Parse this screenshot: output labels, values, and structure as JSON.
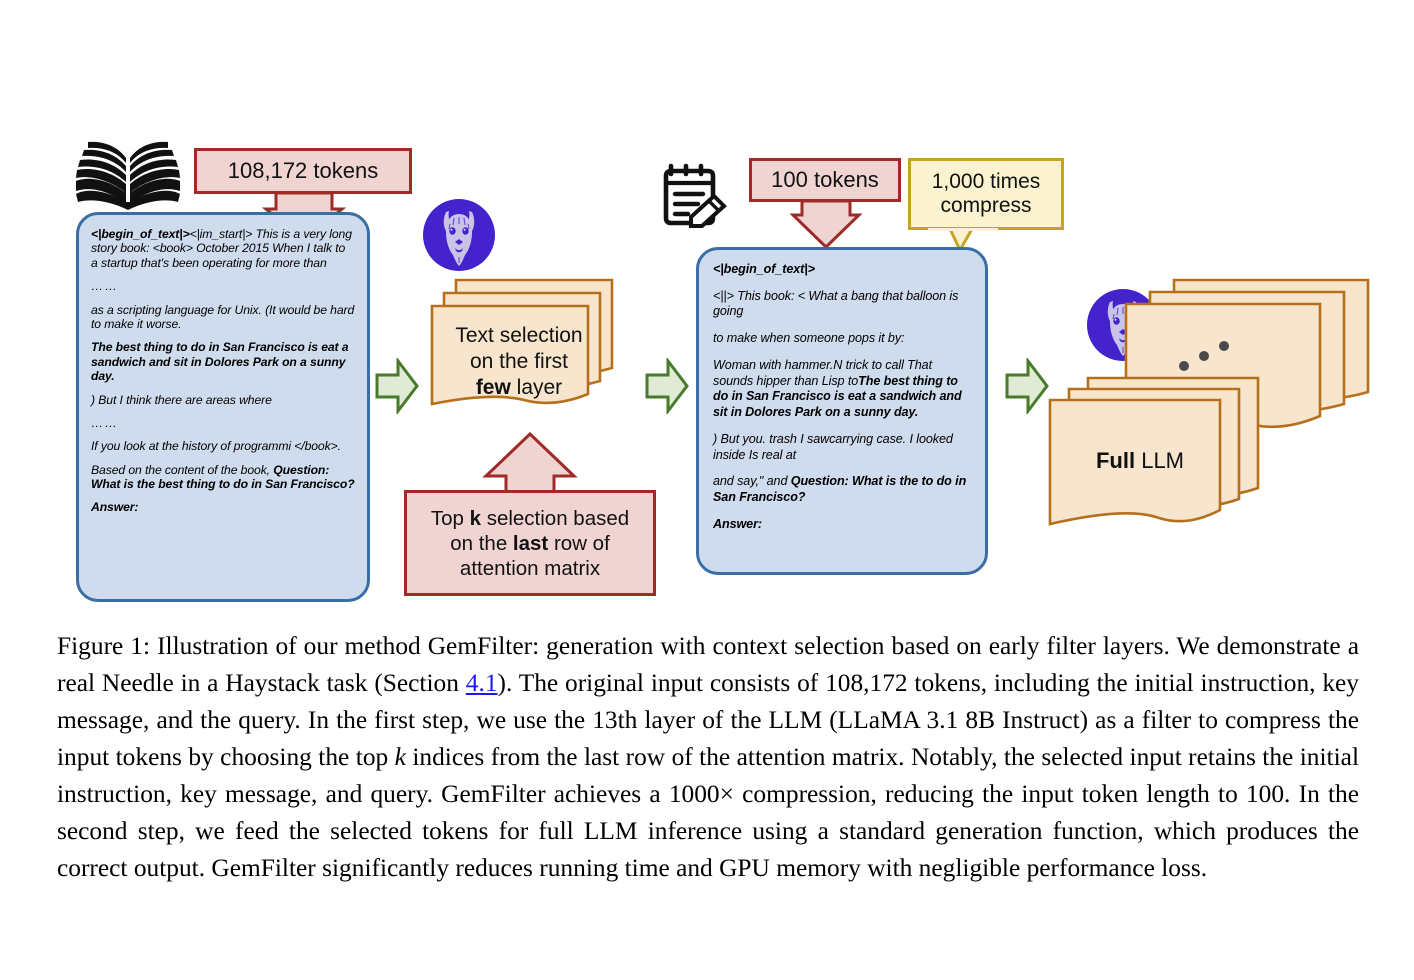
{
  "figure": {
    "icons": {
      "book": "open-book-icon",
      "notepad": "notepad-pencil-icon",
      "llama": "llama-avatar-icon"
    },
    "callouts": {
      "input_tokens": "108,172 tokens",
      "output_tokens": "100 tokens",
      "compress_line1": "1,000 times",
      "compress_line2": "compress"
    },
    "left_prompt": {
      "name": "original-input-prompt",
      "lines": [
        {
          "id": "l1",
          "segments": [
            {
              "text": "<|begin_of_text|>",
              "bold": true
            },
            {
              "text": "<|im_start|> This is a very long story book: <book> October 2015 When I talk to a startup that's been operating for more than",
              "bold": false
            }
          ]
        },
        {
          "id": "l2",
          "segments": [
            {
              "text": "……",
              "bold": false
            }
          ]
        },
        {
          "id": "l3",
          "segments": [
            {
              "text": "as a scripting language for Unix. (It would be hard to make it worse.",
              "bold": false
            }
          ]
        },
        {
          "id": "l4",
          "segments": [
            {
              "text": "The best thing to do in San Francisco is eat a sandwich and sit in Dolores Park on a sunny day.",
              "bold": true
            }
          ]
        },
        {
          "id": "l5",
          "segments": [
            {
              "text": ") But I think there are areas where",
              "bold": false
            }
          ]
        },
        {
          "id": "l6",
          "segments": [
            {
              "text": "……",
              "bold": false
            }
          ]
        },
        {
          "id": "l7",
          "segments": [
            {
              "text": "If you look at the history of programmi </book>.",
              "bold": false
            }
          ]
        },
        {
          "id": "l8",
          "segments": [
            {
              "text": "Based on the content of the book, ",
              "bold": false
            },
            {
              "text": "Question: What is the best thing to do in San Francisco?",
              "bold": true
            }
          ]
        },
        {
          "id": "l9",
          "segments": [
            {
              "text": "Answer:",
              "bold": true
            }
          ]
        }
      ]
    },
    "right_prompt": {
      "name": "compressed-input-prompt",
      "lines": [
        {
          "id": "r1",
          "segments": [
            {
              "text": "<|begin_of_text|>",
              "bold": true
            }
          ]
        },
        {
          "id": "r2",
          "segments": [
            {
              "text": "<||> This book: < What a bang that balloon is going",
              "bold": false
            }
          ]
        },
        {
          "id": "r3",
          "segments": [
            {
              "text": "to make when someone pops it by:",
              "bold": false
            }
          ]
        },
        {
          "id": "r4",
          "segments": [
            {
              "text": "Woman with hammer.N trick to call That sounds hipper than Lisp to",
              "bold": false
            },
            {
              "text": "The best thing to do in San Francisco is eat a sandwich and sit in Dolores Park on a sunny day.",
              "bold": true
            }
          ]
        },
        {
          "id": "r5",
          "segments": [
            {
              "text": ") But you. trash I sawcarrying case. I looked inside Is real at",
              "bold": false
            }
          ]
        },
        {
          "id": "r6",
          "segments": [
            {
              "text": "and say,\" and ",
              "bold": false
            },
            {
              "text": "Question: What is the to do in San Francisco?",
              "bold": true
            }
          ]
        },
        {
          "id": "r7",
          "segments": [
            {
              "text": "Answer:",
              "bold": true
            }
          ]
        }
      ]
    },
    "mid_card": {
      "line1": "Text selection",
      "line2": "on the first",
      "line3_bold": "few",
      "line3_rest": " layer"
    },
    "topk_box": {
      "line1_a": "Top ",
      "line1_b": "k",
      "line1_c": " selection based",
      "line2_a": "on the ",
      "line2_b": "last",
      "line2_c": " row of",
      "line3": "attention matrix"
    },
    "full_llm": {
      "bold": "Full",
      "rest": " LLM"
    },
    "colors": {
      "prompt_fill": "#cfdcee",
      "prompt_border": "#3a6ea5",
      "red_fill": "#f0d4d2",
      "red_border": "#9e2b25",
      "yellow_fill": "#fbf3d0",
      "yellow_border": "#c4a325",
      "card_fill": "#f8e5cd",
      "card_border": "#b5701c",
      "green_fill": "#dfebd4",
      "green_border": "#4a7a2b",
      "llama_circle": "#4422cc",
      "llama_body": "#c9c3e8",
      "link_blue": "#1a1aee"
    }
  },
  "caption": {
    "p1": "Figure 1: Illustration of our method GemFilter: generation with context selection based on early filter layers. We demonstrate a real Needle in a Haystack task (Section ",
    "link": "4.1",
    "p2": "). The original input consists of 108,172 tokens, including the initial instruction, key message, and the query. In the first step, we use the 13th layer of the LLM (LLaMA 3.1 8B Instruct) as a filter to compress the input tokens by choosing the top ",
    "k": "k",
    "p3": " indices from the last row of the attention matrix. Notably, the selected input retains the initial instruction, key message, and query. GemFilter achieves a 1000× compression, reducing the input token length to 100. In the second step, we feed the selected tokens for full LLM inference using a standard generation function, which produces the correct output. GemFilter significantly reduces running time and GPU memory with negligible performance loss."
  }
}
